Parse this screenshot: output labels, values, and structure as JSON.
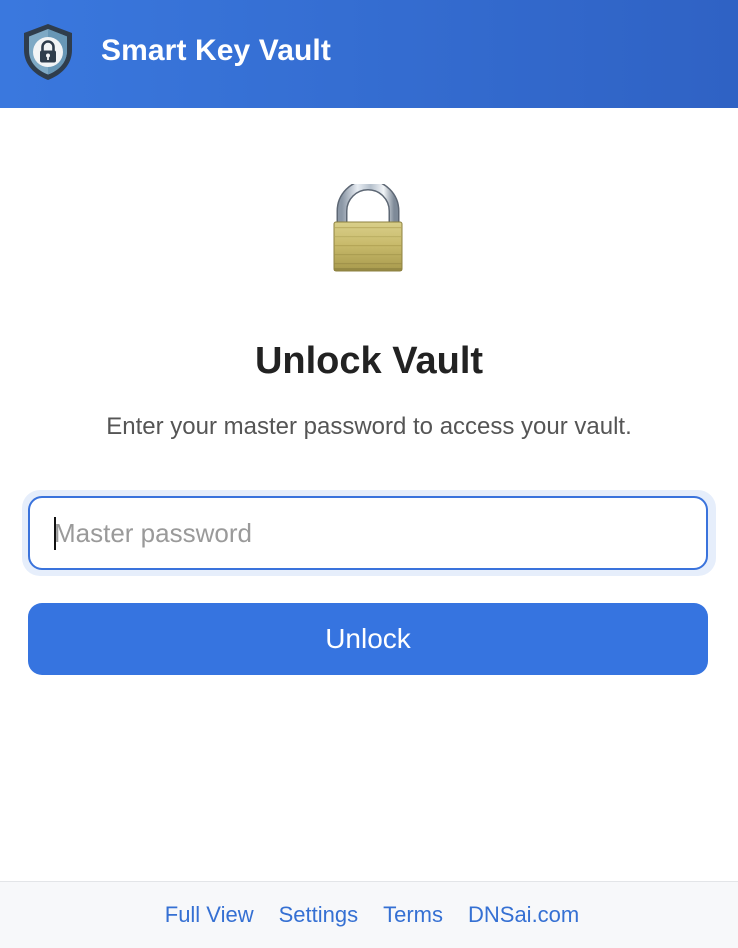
{
  "header": {
    "app_title": "Smart Key Vault",
    "logo_icon": "shield-lock-icon"
  },
  "main": {
    "illustration_icon": "padlock-icon",
    "title": "Unlock Vault",
    "subtitle": "Enter your master password to access your vault.",
    "password_field": {
      "value": "",
      "placeholder": "Master password",
      "type": "password"
    },
    "unlock_button_label": "Unlock"
  },
  "footer": {
    "links": [
      {
        "label": "Full View"
      },
      {
        "label": "Settings"
      },
      {
        "label": "Terms"
      },
      {
        "label": "DNSai.com"
      }
    ]
  },
  "colors": {
    "header_start": "#3a78de",
    "header_end": "#2f62c4",
    "accent": "#3674e0",
    "title_text": "#222222",
    "subtitle_text": "#555555",
    "link_text": "#3570d3",
    "footer_bg": "#f7f8fa"
  }
}
